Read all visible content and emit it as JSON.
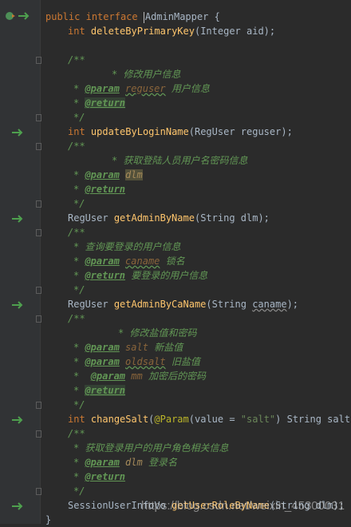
{
  "code": {
    "public_kw": "public",
    "interface_kw": "interface",
    "mapper_name": "AdminMapper",
    "open_brace": "{",
    "close_brace": "}",
    "int_kw": "int",
    "m1_name": "deleteByPrimaryKey",
    "m1_args": "(Integer aid);",
    "c1_open": "/**",
    "c1_desc": "* 修改用户信息",
    "c1_param_tag": "@param",
    "c1_param_name": "reguser",
    "c1_param_desc": "用户信息",
    "c1_return_tag": "@return",
    "c1_close": "*/",
    "m2_name": "updateByLoginName",
    "m2_args": "(RegUser reguser);",
    "c2_open": "/**",
    "c2_desc": "* 获取登陆人员用户名密码信息",
    "c2_param_tag": "@param",
    "c2_param_name": "dlm",
    "c2_return_tag": "@return",
    "c2_close": "*/",
    "m3_type": "RegUser",
    "m3_name": "getAdminByName",
    "m3_args": "(String dlm);",
    "c3_open": "/**",
    "c3_desc": "* 查询要登录的用户信息",
    "c3_param_tag": "@param",
    "c3_param_name": "caname",
    "c3_param_desc": "锁名",
    "c3_return_tag": "@return",
    "c3_return_desc": "要登录的用户信息",
    "c3_close": "*/",
    "m4_type": "RegUser",
    "m4_name": "getAdminByCaName",
    "m4_args_a": "(String ",
    "m4_args_b": "caname",
    "m4_args_c": ");",
    "c4_open": "/**",
    "c4_desc": "* 修改盐值和密码",
    "c4_param1_tag": "@param",
    "c4_param1_name": "salt",
    "c4_param1_desc": "新盐值",
    "c4_param2_tag": "@param",
    "c4_param2_name": "oldsalt",
    "c4_param2_desc": "旧盐值",
    "c4_param3_tag": "@param",
    "c4_param3_name": "mm",
    "c4_param3_desc": "加密后的密码",
    "c4_return_tag": "@return",
    "c4_close": "*/",
    "m5_name": "changeSalt",
    "m5_open": "(",
    "m5_ann": "@Param",
    "m5_ann_args_a": "(value = ",
    "m5_ann_str": "\"salt\"",
    "m5_ann_args_b": ") String salt,",
    "m5_ann_tail": "@",
    "c5_open": "/**",
    "c5_desc": "* 获取登录用户的用户角色相关信息",
    "c5_param_tag": "@param",
    "c5_param_name": "dlm",
    "c5_param_desc": "登录名",
    "c5_return_tag": "@return",
    "c5_close": "*/",
    "m6_type": "SessionUserInfoVo",
    "m6_name": "getUserRoleByName",
    "m6_args": "(String dlm);"
  },
  "watermark": "https://blog.csdn.net/weixin_45300031",
  "gutter_icons": [
    "class-implementation-icon",
    "implementation-arrow-icon",
    "fold-marker-icon"
  ]
}
